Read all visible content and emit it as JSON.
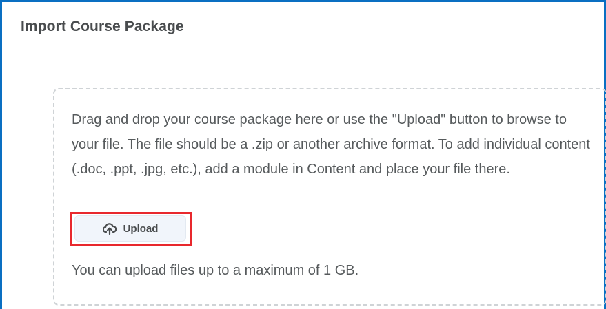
{
  "dialog": {
    "title": "Import Course Package",
    "instructions": "Drag and drop your course package here or use the \"Upload\" button to browse to your file. The file should be a .zip or another archive format. To add individual content (.doc, .ppt, .jpg, etc.), add a module in Content and place your file there.",
    "upload_button": {
      "label": "Upload",
      "icon": "cloud-upload-icon"
    },
    "limit_text": "You can upload files up to a maximum of 1 GB."
  },
  "colors": {
    "frame_border": "#0a6fc2",
    "highlight_border": "#e8282d",
    "dropzone_border": "#cfd3d6",
    "button_background": "#f1f5fb",
    "text": "#565a5c",
    "title_text": "#494c4e"
  }
}
